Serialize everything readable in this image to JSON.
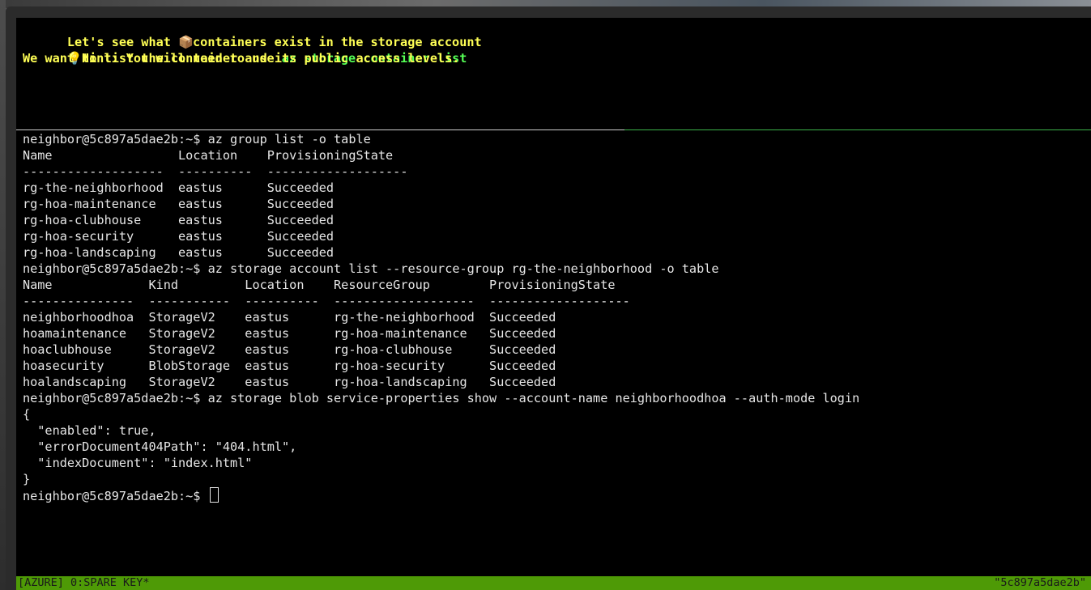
{
  "hint": {
    "line1_prefix": "Let's see what ",
    "line1_emoji": "📦",
    "line1_suffix": "containers exist in the storage account",
    "line2_emoji": "💡",
    "line2_prefix": "Hint: You will need to use ",
    "line2_command": "az storage container list",
    "line3": "We want to list the container and its public access levels."
  },
  "terminal": {
    "lines": [
      "neighbor@5c897a5dae2b:~$ az group list -o table",
      "Name                 Location    ProvisioningState",
      "-------------------  ----------  -------------------",
      "rg-the-neighborhood  eastus      Succeeded",
      "rg-hoa-maintenance   eastus      Succeeded",
      "rg-hoa-clubhouse     eastus      Succeeded",
      "rg-hoa-security      eastus      Succeeded",
      "rg-hoa-landscaping   eastus      Succeeded",
      "neighbor@5c897a5dae2b:~$ az storage account list --resource-group rg-the-neighborhood -o table",
      "Name             Kind         Location    ResourceGroup        ProvisioningState",
      "---------------  -----------  ----------  -------------------  -------------------",
      "neighborhoodhoa  StorageV2    eastus      rg-the-neighborhood  Succeeded",
      "hoamaintenance   StorageV2    eastus      rg-hoa-maintenance   Succeeded",
      "hoaclubhouse     StorageV2    eastus      rg-hoa-clubhouse     Succeeded",
      "hoasecurity      BlobStorage  eastus      rg-hoa-security      Succeeded",
      "hoalandscaping   StorageV2    eastus      rg-hoa-landscaping   Succeeded",
      "neighbor@5c897a5dae2b:~$ az storage blob service-properties show --account-name neighborhoodhoa --auth-mode login",
      "{",
      "  \"enabled\": true,",
      "  \"errorDocument404Path\": \"404.html\",",
      "  \"indexDocument\": \"index.html\"",
      "}"
    ],
    "prompt": "neighbor@5c897a5dae2b:~$ "
  },
  "status_bar": {
    "left": "[AZURE] 0:SPARE KEY*",
    "right": "\"5c897a5dae2b\""
  },
  "colors": {
    "hint_yellow": "#ffff55",
    "hint_green": "#55ff55",
    "status_green": "#4e9a06"
  }
}
